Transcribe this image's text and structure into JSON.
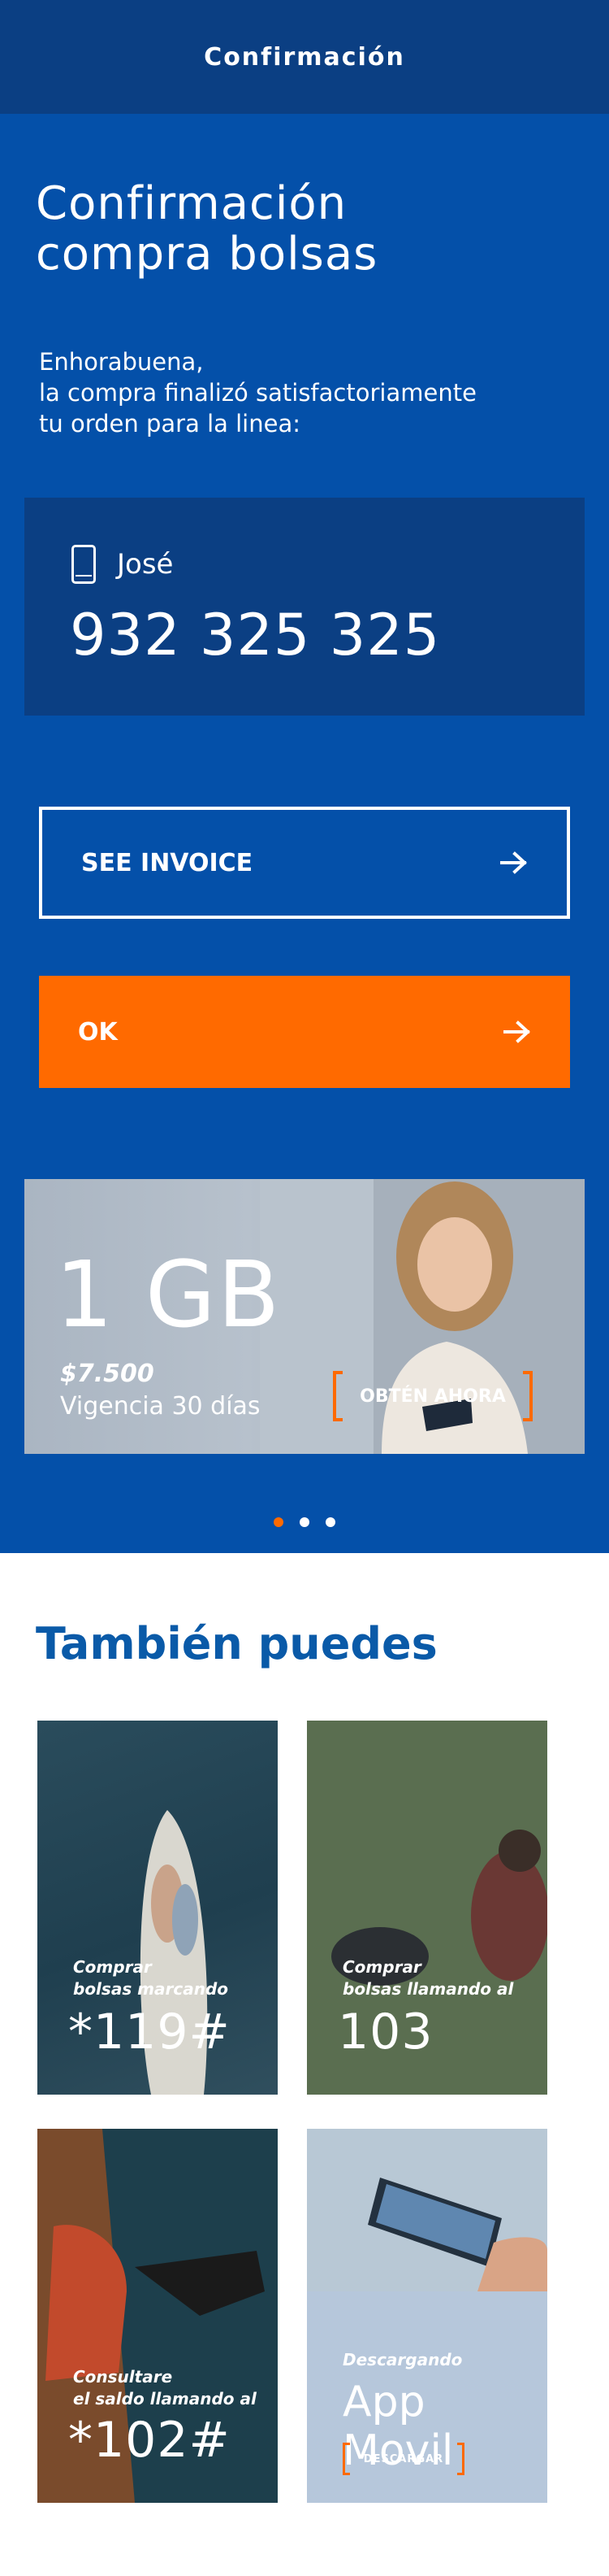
{
  "header": {
    "title": "Confirmación"
  },
  "main": {
    "title_line1": "Confirmación",
    "title_line2": "compra bolsas",
    "intro_line1": "Enhorabuena,",
    "intro_line2": "la compra finalizó satisfactoriamente",
    "intro_line3": "tu orden para la linea:"
  },
  "line": {
    "name": "José",
    "number": "932 325 325",
    "icon": "phone-icon"
  },
  "buttons": {
    "invoice": "SEE INVOICE",
    "ok": "OK",
    "arrow_icon": "arrow-right-icon"
  },
  "promo": {
    "size": "1 GB",
    "price": "$7.500",
    "validity": "Vigencia 30 días",
    "cta": "OBTÉN AHORA"
  },
  "carousel": {
    "count": 3,
    "active": 0
  },
  "also": {
    "title": "También puedes",
    "tiles": [
      {
        "line1": "Comprar",
        "line2": "bolsas marcando",
        "code": "*119#"
      },
      {
        "line1": "Comprar",
        "line2": "bolsas llamando al",
        "code": "103"
      },
      {
        "line1": "Consultare",
        "line2": "el saldo llamando al",
        "code": "*102#"
      }
    ],
    "app": {
      "sub": "Descargando",
      "title": "App Movil",
      "cta": "DESCARGAR"
    }
  },
  "colors": {
    "header": "#0b3f83",
    "main": "#0450a9",
    "accent": "#ff6a00",
    "card": "#0b3f83",
    "heading_blue": "#0a5aa8"
  }
}
